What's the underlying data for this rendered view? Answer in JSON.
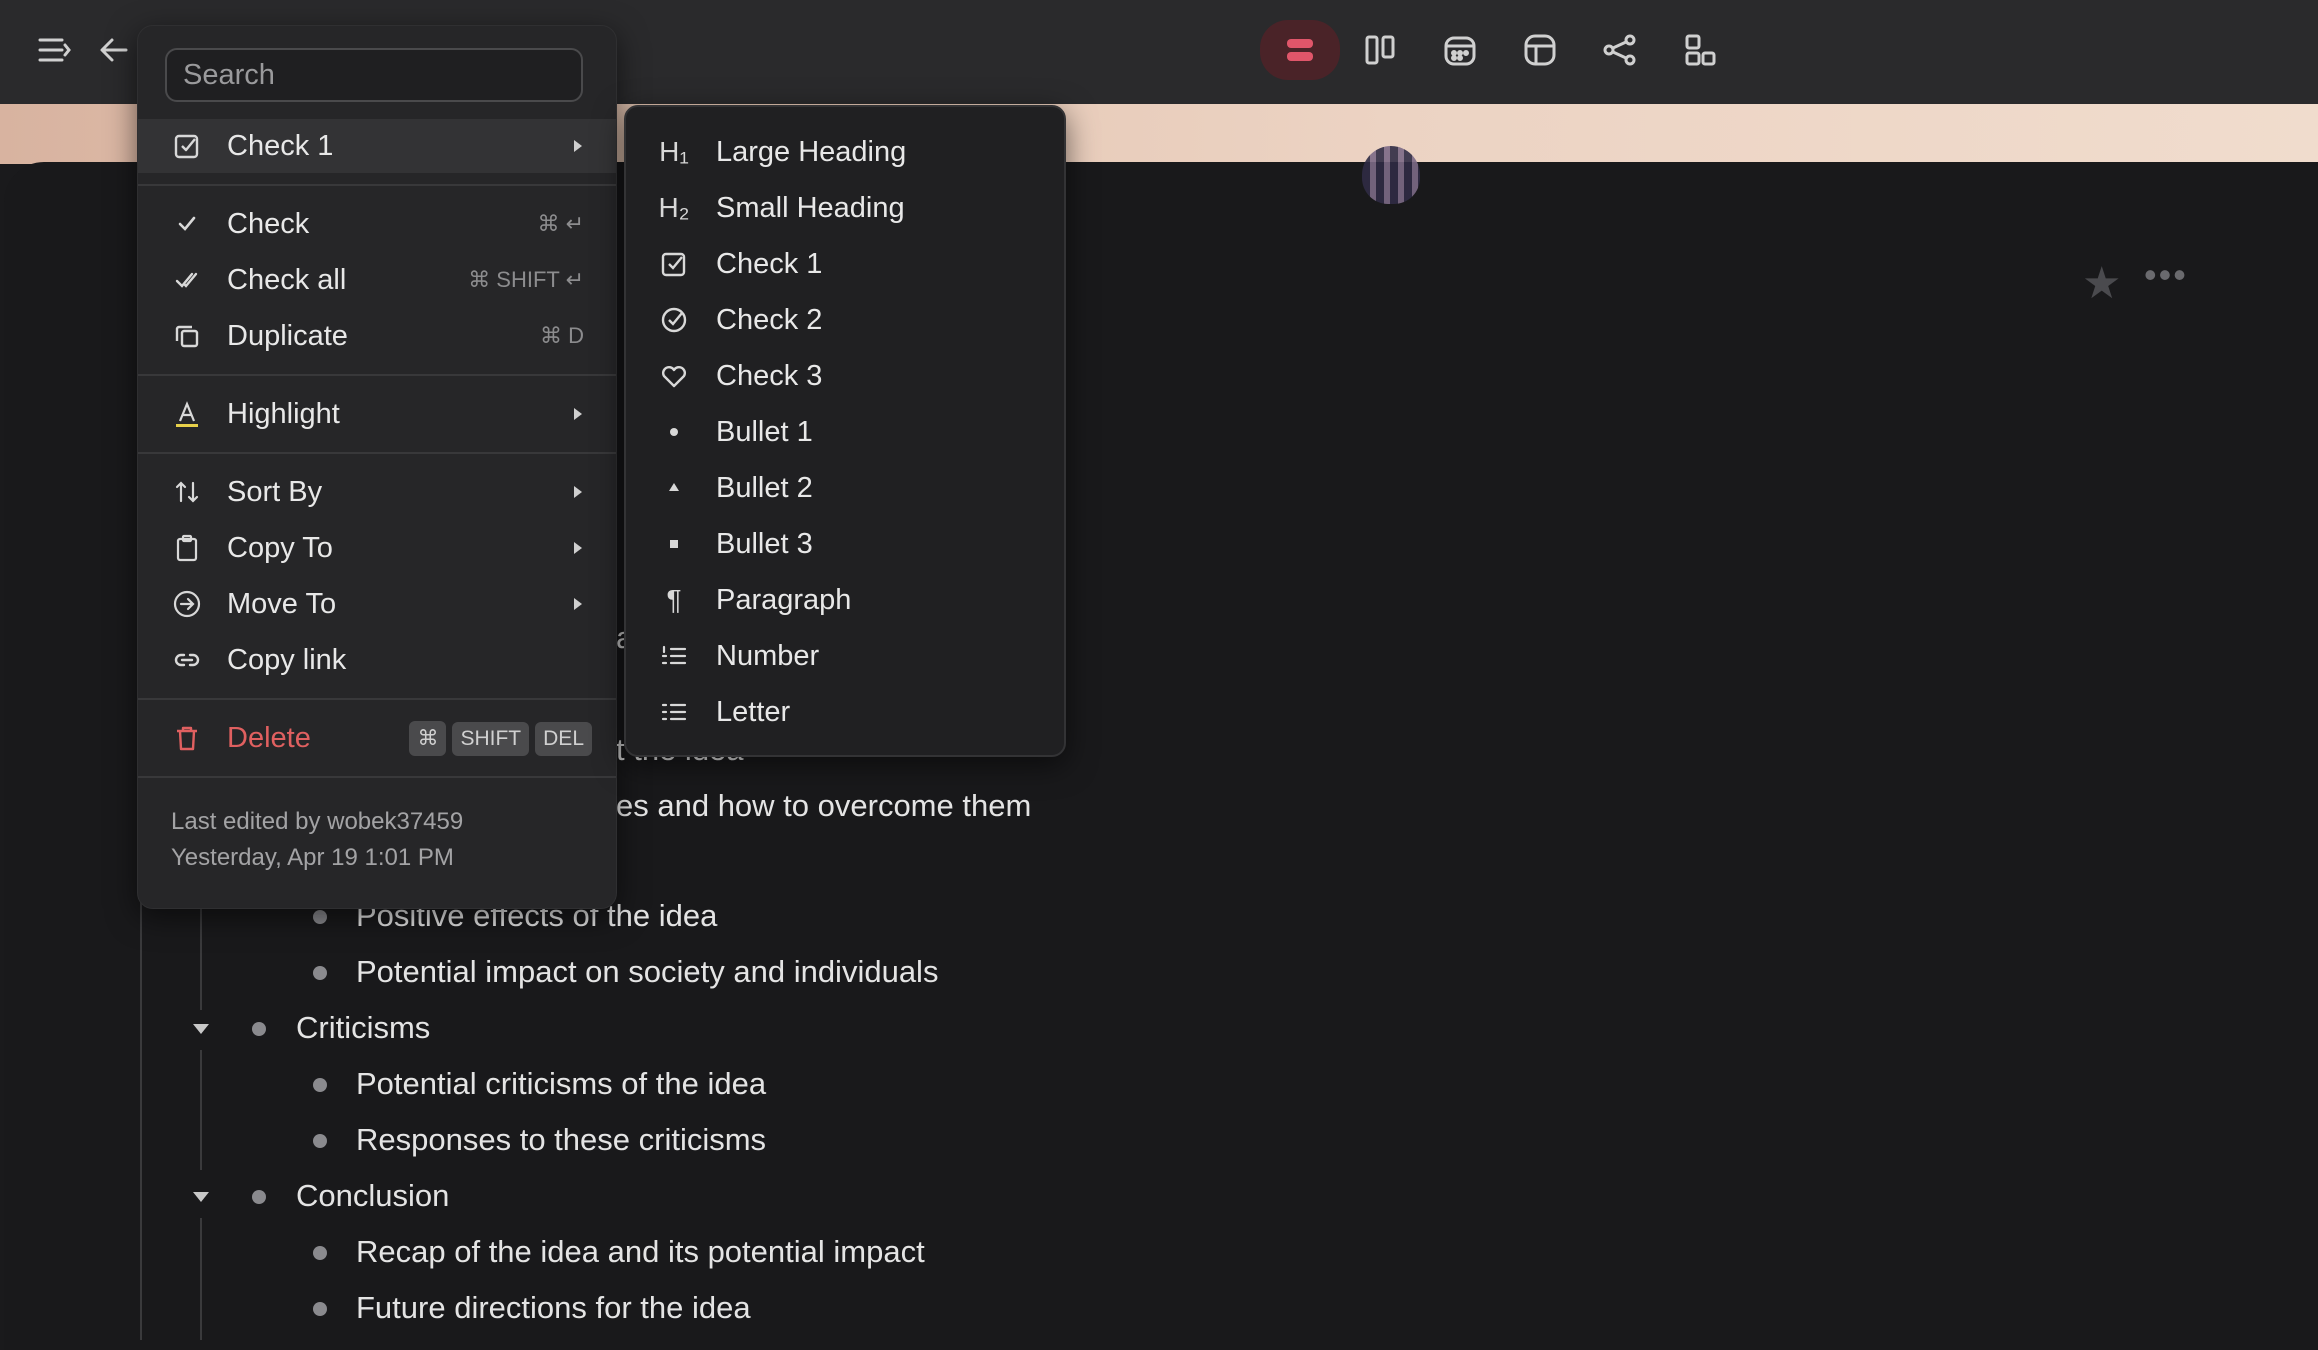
{
  "toolbar": {
    "icons": [
      "menu-icon",
      "back-icon",
      "outline-view-icon",
      "board-view-icon",
      "calendar-view-icon",
      "table-view-icon",
      "share-icon",
      "templates-icon"
    ]
  },
  "outline": {
    "partial_rows": [
      "a",
      "t the idea",
      "es and how to overcome them"
    ],
    "rows": [
      {
        "text": "Positive effects of the idea",
        "level": 2
      },
      {
        "text": "Potential impact on society and individuals",
        "level": 2
      },
      {
        "text": "Criticisms",
        "level": 1
      },
      {
        "text": "Potential criticisms of the idea",
        "level": 2
      },
      {
        "text": "Responses to these criticisms",
        "level": 2
      },
      {
        "text": "Conclusion",
        "level": 1
      },
      {
        "text": "Recap of the idea and its potential impact",
        "level": 2
      },
      {
        "text": "Future directions for the idea",
        "level": 2
      }
    ]
  },
  "menu": {
    "search_placeholder": "Search",
    "items": [
      {
        "label": "Check 1",
        "icon": "checkbox-icon",
        "submenu": true
      },
      {
        "label": "Check",
        "icon": "check-icon",
        "shortcut": "⌘ ↵"
      },
      {
        "label": "Check all",
        "icon": "double-check-icon",
        "shortcut": "⌘ SHIFT ↵"
      },
      {
        "label": "Duplicate",
        "icon": "duplicate-icon",
        "shortcut": "⌘ D"
      },
      {
        "label": "Highlight",
        "icon": "highlight-icon",
        "submenu": true
      },
      {
        "label": "Sort By",
        "icon": "sort-icon",
        "submenu": true
      },
      {
        "label": "Copy To",
        "icon": "clipboard-icon",
        "submenu": true
      },
      {
        "label": "Move To",
        "icon": "move-icon",
        "submenu": true
      },
      {
        "label": "Copy link",
        "icon": "link-icon"
      },
      {
        "label": "Delete",
        "icon": "trash-icon",
        "keys": [
          "⌘",
          "SHIFT",
          "DEL"
        ]
      }
    ],
    "last_edited": "Last edited by wobek37459",
    "edited_time": "Yesterday, Apr 19 1:01 PM"
  },
  "submenu": {
    "items": [
      {
        "label": "Large Heading",
        "glyph": "H₁"
      },
      {
        "label": "Small Heading",
        "glyph": "H₂"
      },
      {
        "label": "Check 1"
      },
      {
        "label": "Check 2"
      },
      {
        "label": "Check 3"
      },
      {
        "label": "Bullet 1"
      },
      {
        "label": "Bullet 2"
      },
      {
        "label": "Bullet 3"
      },
      {
        "label": "Paragraph",
        "glyph": "¶"
      },
      {
        "label": "Number"
      },
      {
        "label": "Letter"
      }
    ]
  },
  "colors": {
    "accent": "#e0566a",
    "delete": "#e06060",
    "highlight_underline": "#e7d04a"
  }
}
